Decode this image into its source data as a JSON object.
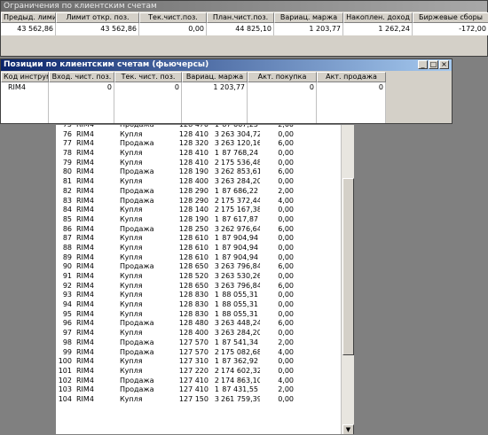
{
  "limits": {
    "title": "Ограничения по клиентским счетам",
    "headers": [
      "Предыд. лимит откр",
      "Лимит откр. поз.",
      "Тек.чист.поз.",
      "План.чист.поз.",
      "Вариац. маржа",
      "Накоплен. доход",
      "Биржевые сборы"
    ],
    "values": [
      "43 562,86",
      "43 562,86",
      "0,00",
      "44 825,10",
      "1 203,77",
      "1 262,24",
      "-172,00"
    ]
  },
  "positions": {
    "title": "Позиции по клиентским счетам (фьючерсы)",
    "headers": [
      "Код инструм",
      "Вход. чист. поз.",
      "Тек. чист. поз.",
      "Вариац. маржа",
      "Акт. покупка",
      "Акт. продажа"
    ],
    "values": [
      "RIM4",
      "0",
      "0",
      "1 203,77",
      "0",
      "0"
    ]
  },
  "trades": {
    "rows": [
      [
        "75",
        "RIM4",
        "Продажа",
        "128 470",
        "1",
        "87 667,25",
        "2,00"
      ],
      [
        "76",
        "RIM4",
        "Купля",
        "128 410",
        "3",
        "263 304,72",
        "0,00"
      ],
      [
        "77",
        "RIM4",
        "Продажа",
        "128 320",
        "3",
        "263 120,16",
        "6,00"
      ],
      [
        "78",
        "RIM4",
        "Купля",
        "128 410",
        "1",
        "87 768,24",
        "0,00"
      ],
      [
        "79",
        "RIM4",
        "Купля",
        "128 410",
        "2",
        "175 536,48",
        "0,00"
      ],
      [
        "80",
        "RIM4",
        "Продажа",
        "128 190",
        "3",
        "262 853,61",
        "6,00"
      ],
      [
        "81",
        "RIM4",
        "Купля",
        "128 400",
        "3",
        "263 284,20",
        "0,00"
      ],
      [
        "82",
        "RIM4",
        "Продажа",
        "128 290",
        "1",
        "87 686,22",
        "2,00"
      ],
      [
        "83",
        "RIM4",
        "Продажа",
        "128 290",
        "2",
        "175 372,44",
        "4,00"
      ],
      [
        "84",
        "RIM4",
        "Купля",
        "128 140",
        "2",
        "175 167,38",
        "0,00"
      ],
      [
        "85",
        "RIM4",
        "Купля",
        "128 190",
        "1",
        "87 617,87",
        "0,00"
      ],
      [
        "86",
        "RIM4",
        "Продажа",
        "128 250",
        "3",
        "262 976,64",
        "6,00"
      ],
      [
        "87",
        "RIM4",
        "Купля",
        "128 610",
        "1",
        "87 904,94",
        "0,00"
      ],
      [
        "88",
        "RIM4",
        "Купля",
        "128 610",
        "1",
        "87 904,94",
        "0,00"
      ],
      [
        "89",
        "RIM4",
        "Купля",
        "128 610",
        "1",
        "87 904,94",
        "0,00"
      ],
      [
        "90",
        "RIM4",
        "Продажа",
        "128 650",
        "3",
        "263 796,84",
        "6,00"
      ],
      [
        "91",
        "RIM4",
        "Купля",
        "128 520",
        "3",
        "263 530,26",
        "0,00"
      ],
      [
        "92",
        "RIM4",
        "Купля",
        "128 650",
        "3",
        "263 796,84",
        "6,00"
      ],
      [
        "93",
        "RIM4",
        "Купля",
        "128 830",
        "1",
        "88 055,31",
        "0,00"
      ],
      [
        "94",
        "RIM4",
        "Купля",
        "128 830",
        "1",
        "88 055,31",
        "0,00"
      ],
      [
        "95",
        "RIM4",
        "Купля",
        "128 830",
        "1",
        "88 055,31",
        "0,00"
      ],
      [
        "96",
        "RIM4",
        "Продажа",
        "128 480",
        "3",
        "263 448,24",
        "6,00"
      ],
      [
        "97",
        "RIM4",
        "Купля",
        "128 400",
        "3",
        "263 284,20",
        "0,00"
      ],
      [
        "98",
        "RIM4",
        "Продажа",
        "127 570",
        "1",
        "87 541,34",
        "2,00"
      ],
      [
        "99",
        "RIM4",
        "Продажа",
        "127 570",
        "2",
        "175 082,68",
        "4,00"
      ],
      [
        "100",
        "RIM4",
        "Купля",
        "127 310",
        "1",
        "87 362,92",
        "0,00"
      ],
      [
        "101",
        "RIM4",
        "Купля",
        "127 220",
        "2",
        "174 602,32",
        "0,00"
      ],
      [
        "102",
        "RIM4",
        "Продажа",
        "127 410",
        "2",
        "174 863,10",
        "4,00"
      ],
      [
        "103",
        "RIM4",
        "Продажа",
        "127 410",
        "1",
        "87 431,55",
        "2,00"
      ],
      [
        "104",
        "RIM4",
        "Купля",
        "127 150",
        "3",
        "261 759,39",
        "0,00"
      ]
    ],
    "scroll_down_icon": "arrow-down-icon"
  }
}
